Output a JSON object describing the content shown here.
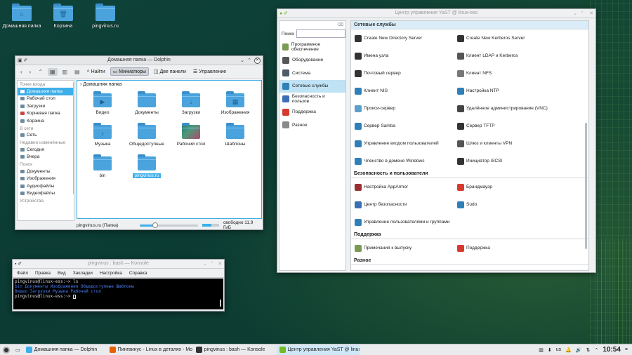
{
  "desktop": {
    "icons": [
      {
        "label": "Домашняя папка",
        "icon": "home-icon"
      },
      {
        "label": "Корзина",
        "icon": "trash-icon"
      },
      {
        "label": "pingvinus.ru",
        "icon": "folder-icon"
      }
    ]
  },
  "dolphin": {
    "title": "Домашняя папка — Dolphin",
    "toolbar": {
      "find": "Найти",
      "icons_view": "Миниатюры",
      "split": "Две панели",
      "control": "Управление"
    },
    "sidebar": {
      "sections": [
        {
          "heading": "Точки входа",
          "items": [
            "Домашняя папка",
            "Рабочий стол",
            "Загрузки",
            "Корневая папка",
            "Корзина"
          ]
        },
        {
          "heading": "В сети",
          "items": [
            "Сеть"
          ]
        },
        {
          "heading": "Недавно изменённые",
          "items": [
            "Сегодня",
            "Вчера"
          ]
        },
        {
          "heading": "Поиск",
          "items": [
            "Документы",
            "Изображения",
            "Аудиофайлы",
            "Видеофайлы"
          ]
        },
        {
          "heading": "Устройства",
          "items": []
        }
      ],
      "selected": "Домашняя папка"
    },
    "breadcrumb": "Домашняя папка",
    "files": [
      "Видео",
      "Документы",
      "Загрузки",
      "Изображения",
      "Музыка",
      "Общедоступные",
      "Рабочий стол",
      "Шаблоны",
      "bin",
      "pingvinus.ru"
    ],
    "selected_file": "pingvinus.ru",
    "status": {
      "selection": "pingvinus.ru (Папка)",
      "free": "свободно 11,9 ГиБ",
      "zoom_fraction": 0.27,
      "used_fraction": 0.55
    }
  },
  "yast": {
    "title": "Центр управления YaST @ linux-ess",
    "search_label": "Поиск",
    "categories": [
      {
        "label": "Программное обеспечение",
        "color": "#7a9a55"
      },
      {
        "label": "Оборудование",
        "color": "#555555"
      },
      {
        "label": "Система",
        "color": "#4f5d6b"
      },
      {
        "label": "Сетевые службы",
        "color": "#2f7fb8"
      },
      {
        "label": "Безопасность и пользов",
        "color": "#3a6fb5"
      },
      {
        "label": "Поддержка",
        "color": "#d63a2f"
      },
      {
        "label": "Разное",
        "color": "#8a8a8a"
      }
    ],
    "selected_category": "Сетевые службы",
    "groups": [
      {
        "heading": "Сетевые службы",
        "items": [
          {
            "label": "Create New Directory Server",
            "color": "#333333"
          },
          {
            "label": "Create New Kerberos Server",
            "color": "#333333"
          },
          {
            "label": "Имена узла",
            "color": "#333333"
          },
          {
            "label": "Клиент LDAP и Kerberos",
            "color": "#555555"
          },
          {
            "label": "Почтовый сервер",
            "color": "#333333"
          },
          {
            "label": "Клиент NFS",
            "color": "#777777"
          },
          {
            "label": "Клиент NIS",
            "color": "#2f7fb8"
          },
          {
            "label": "Настройка NTP",
            "color": "#2f7fb8"
          },
          {
            "label": "Прокси-сервер",
            "color": "#5aa0c8"
          },
          {
            "label": "Удалённое администрирование (VNC)",
            "color": "#444444"
          },
          {
            "label": "Сервер Samba",
            "color": "#2f7fb8"
          },
          {
            "label": "Сервер TFTP",
            "color": "#333333"
          },
          {
            "label": "Управление входом пользователей",
            "color": "#2f7fb8"
          },
          {
            "label": "Шлюз и клиенты VPN",
            "color": "#555555"
          },
          {
            "label": "Членство в домене Windows",
            "color": "#2f7fb8"
          },
          {
            "label": "Инициатор iSCSI",
            "color": "#333333"
          }
        ]
      },
      {
        "heading": "Безопасность и пользователи",
        "items": [
          {
            "label": "Настройка AppArmor",
            "color": "#9a2f2f"
          },
          {
            "label": "Брандмауэр",
            "color": "#d63a2f"
          },
          {
            "label": "Центр безопасности",
            "color": "#3a6fb5"
          },
          {
            "label": "Sudo",
            "color": "#2f7fb8"
          },
          {
            "label": "Управление пользователями и группами",
            "color": "#2f7fb8"
          }
        ]
      },
      {
        "heading": "Поддержка",
        "items": [
          {
            "label": "Примечания к выпуску",
            "color": "#7a9a55"
          },
          {
            "label": "Поддержка",
            "color": "#d63a2f"
          }
        ]
      },
      {
        "heading": "Разное",
        "items": []
      }
    ]
  },
  "konsole": {
    "title": "pingvinus : bash — Konsole",
    "menu": [
      "Файл",
      "Правка",
      "Вид",
      "Закладки",
      "Настройка",
      "Справка"
    ],
    "lines": [
      {
        "prompt": "pingvinus@linux-ess:~> ls",
        "blue": ""
      },
      {
        "prompt": "",
        "blue": "bin   Документы  Изображения  Общедоступные  Шаблоны"
      },
      {
        "prompt": "",
        "blue": "Видео  Загрузки   Музыка      Рабочий стол"
      },
      {
        "prompt": "pingvinus@linux-ess:~> ",
        "blue": ""
      }
    ]
  },
  "taskbar": {
    "tasks": [
      {
        "label": "Домашняя папка — Dolphin",
        "color": "#3daee9"
      },
      {
        "label": "Пингвинус - Linux в деталях - Mo...",
        "color": "#e66000"
      },
      {
        "label": "pingvinus : bash — Konsole",
        "color": "#333333"
      },
      {
        "label": "Центр управления YaST @ linux-...",
        "color": "#73ba25"
      }
    ],
    "layout": "us",
    "clock": "10:54"
  }
}
